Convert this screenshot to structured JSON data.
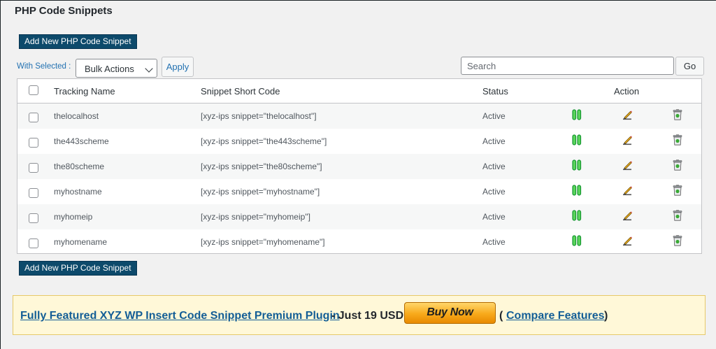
{
  "page": {
    "title": "PHP Code Snippets"
  },
  "toolbar": {
    "add_label": "Add New PHP Code Snippet",
    "with_selected": "With Selected :",
    "bulk_value": "Bulk Actions",
    "apply_label": "Apply",
    "search_placeholder": "Search",
    "go_label": "Go"
  },
  "table": {
    "headers": {
      "name": "Tracking Name",
      "code": "Snippet Short Code",
      "status": "Status",
      "action": "Action"
    },
    "rows": [
      {
        "name": "thelocalhost",
        "code": "[xyz-ips snippet=\"thelocalhost\"]",
        "status": "Active"
      },
      {
        "name": "the443scheme",
        "code": "[xyz-ips snippet=\"the443scheme\"]",
        "status": "Active"
      },
      {
        "name": "the80scheme",
        "code": "[xyz-ips snippet=\"the80scheme\"]",
        "status": "Active"
      },
      {
        "name": "myhostname",
        "code": "[xyz-ips snippet=\"myhostname\"]",
        "status": "Active"
      },
      {
        "name": "myhomeip",
        "code": "[xyz-ips snippet=\"myhomeip\"]",
        "status": "Active"
      },
      {
        "name": "myhomename",
        "code": "[xyz-ips snippet=\"myhomename\"]",
        "status": "Active"
      }
    ],
    "icons": [
      "pause-icon",
      "edit-icon",
      "delete-icon"
    ]
  },
  "promo": {
    "link_text": "Fully Featured XYZ WP Insert Code Snippet Premium Plugin",
    "price_text": "- Just 19 USD",
    "buy_label": "Buy Now",
    "open_paren": "(",
    "compare_text": "Compare Features",
    "close_paren": ")"
  },
  "colors": {
    "primary_button": "#0d4a6b",
    "link": "#135e96",
    "promo_bg": "#fff8d8",
    "pause_icon": "#22b14c"
  }
}
